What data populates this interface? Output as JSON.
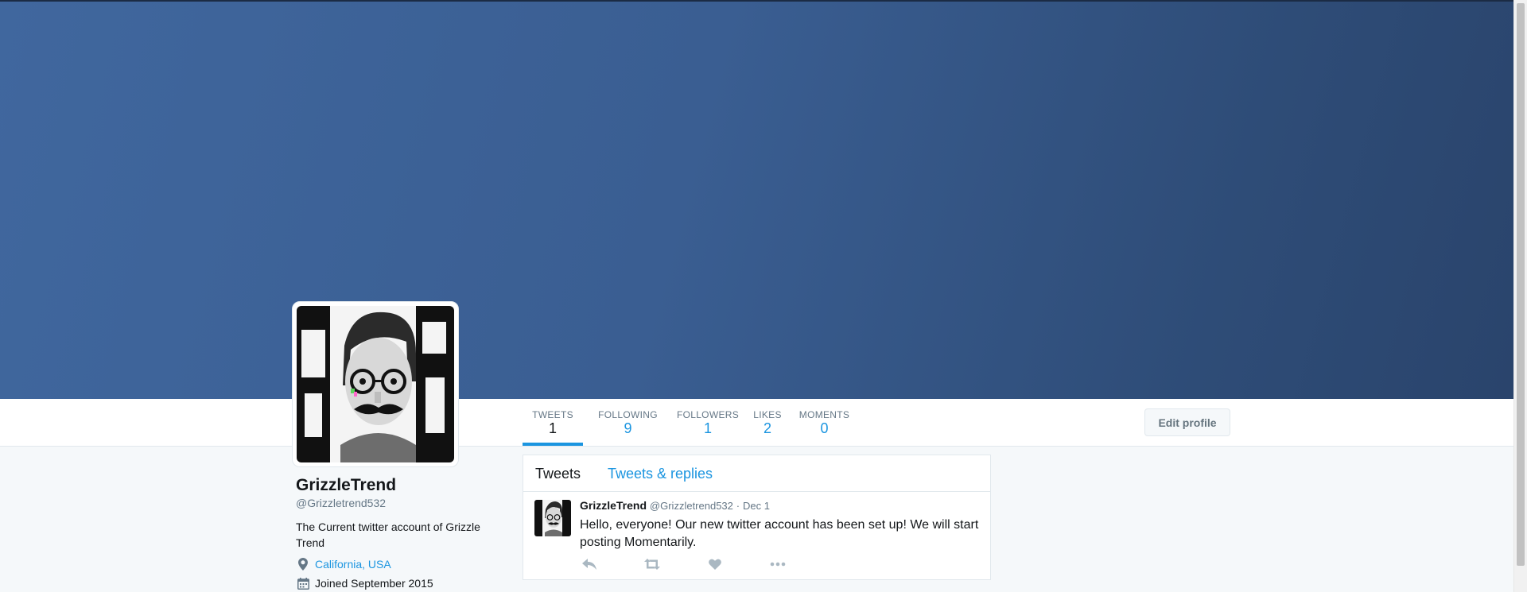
{
  "profile": {
    "name": "GrizzleTrend",
    "handle": "@Grizzletrend532",
    "bio": "The Current twitter account of Grizzle Trend",
    "location": "California, USA",
    "joined": "Joined September 2015"
  },
  "stats": [
    {
      "label": "TWEETS",
      "value": "1"
    },
    {
      "label": "FOLLOWING",
      "value": "9"
    },
    {
      "label": "FOLLOWERS",
      "value": "1"
    },
    {
      "label": "LIKES",
      "value": "2"
    },
    {
      "label": "MOMENTS",
      "value": "0"
    }
  ],
  "edit_profile_label": "Edit profile",
  "timeline": {
    "tabs": [
      "Tweets",
      "Tweets & replies"
    ],
    "tweet": {
      "name": "GrizzleTrend",
      "handle": "@Grizzletrend532",
      "separator": "·",
      "date": "Dec 1",
      "text": "Hello, everyone! Our new twitter account has been set up! We will start posting Momentarily."
    }
  },
  "icons": {
    "location": "location-pin-icon",
    "joined": "calendar-icon",
    "reply": "reply-icon",
    "retweet": "retweet-icon",
    "like": "heart-icon",
    "more": "more-dots-icon"
  },
  "colors": {
    "accent": "#1b95e0",
    "banner": "#3a5e92",
    "muted": "#657786",
    "action_icon": "#aab8c2"
  }
}
